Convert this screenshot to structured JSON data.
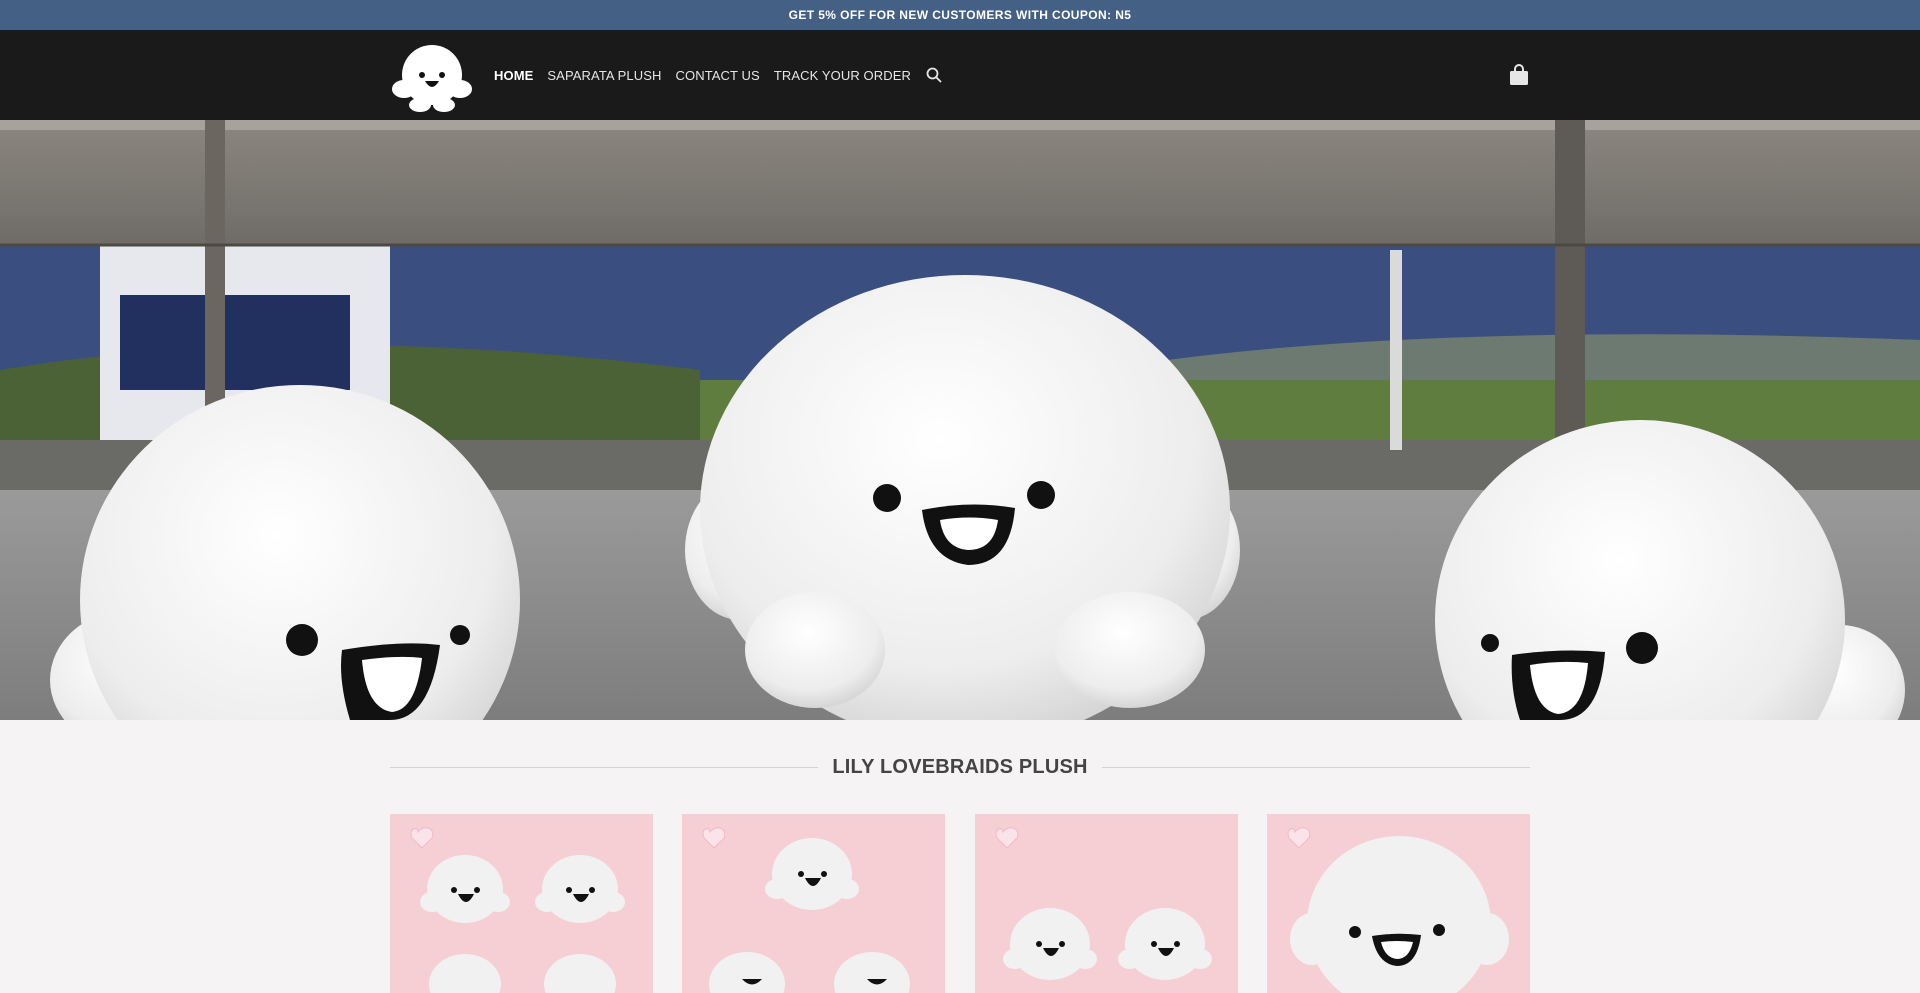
{
  "promo": {
    "text": "GET 5% OFF FOR NEW CUSTOMERS WITH COUPON: N5"
  },
  "header": {
    "nav": [
      {
        "label": "HOME",
        "active": true
      },
      {
        "label": "SAPARATA PLUSH",
        "active": false
      },
      {
        "label": "CONTACT US",
        "active": false
      },
      {
        "label": "TRACK YOUR ORDER",
        "active": false
      }
    ]
  },
  "section": {
    "title": "LILY LOVEBRAIDS PLUSH"
  },
  "colors": {
    "promo_bg": "#446084",
    "header_bg": "#1a1a1a",
    "page_bg": "#f5f3f3",
    "product_bg": "#f6cfd4"
  },
  "icons": {
    "logo": "white-plush-logo",
    "search": "search-icon",
    "cart": "shopping-bag-icon"
  }
}
